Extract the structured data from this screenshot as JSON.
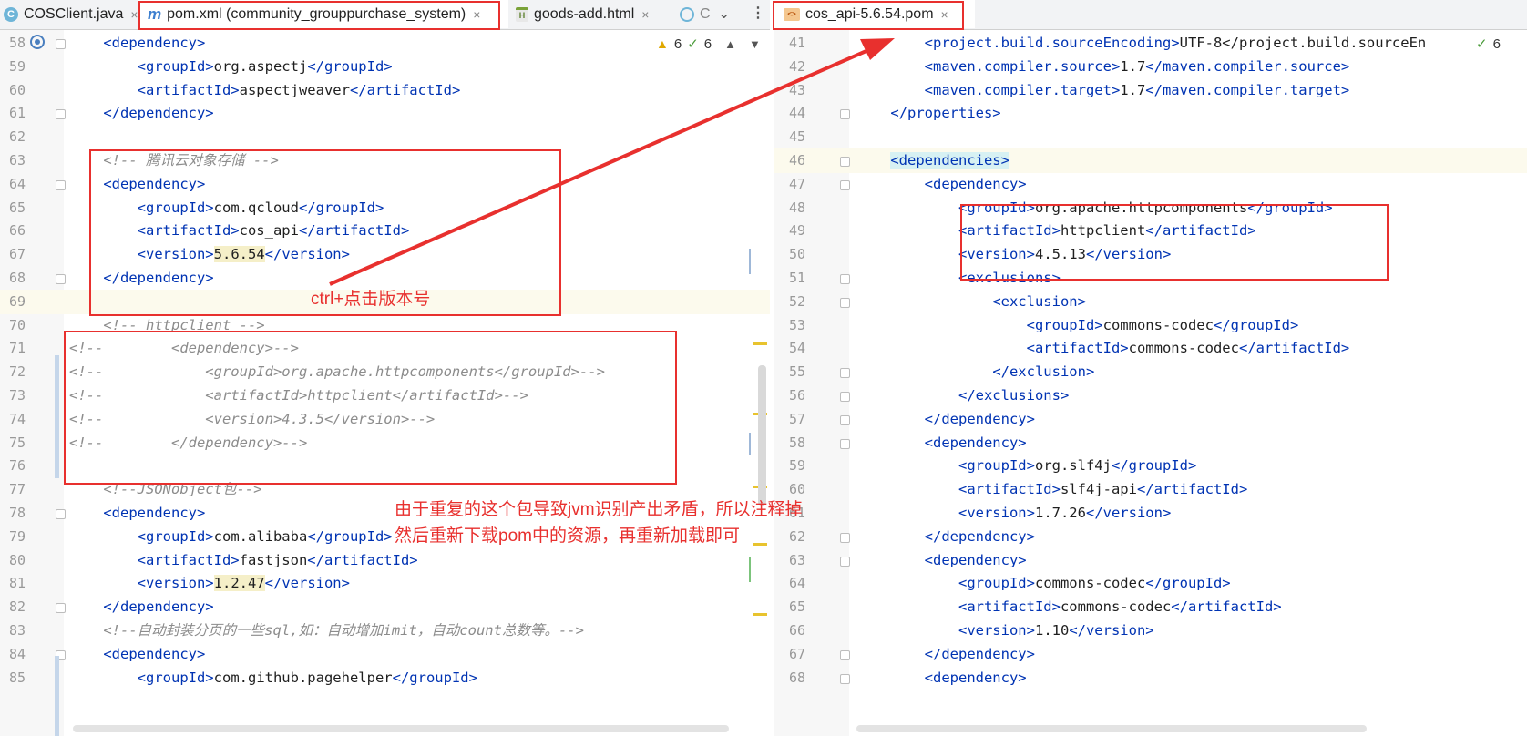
{
  "tabs_left": [
    {
      "label": "COSClient.java",
      "icon": "java-class-icon"
    },
    {
      "label": "pom.xml (community_grouppurchase_system)",
      "icon": "maven-icon"
    },
    {
      "label": "goods-add.html",
      "icon": "html-file-icon"
    },
    {
      "label": "C",
      "icon": "java-class-icon"
    }
  ],
  "tabs_right": [
    {
      "label": "cos_api-5.6.54.pom",
      "icon": "pom-file-icon"
    }
  ],
  "close_glyph": "×",
  "inspections_left": {
    "warnings": "6",
    "ok": "6"
  },
  "inspections_right": {
    "ok": "6"
  },
  "annotations": {
    "ctrl_click": "ctrl+点击版本号",
    "conflict_line1": "由于重复的这个包导致jvm识别产出矛盾，所以注释掉",
    "conflict_line2": "然后重新下载pom中的资源，再重新加载即可"
  },
  "left_code": [
    {
      "n": "58",
      "text": "    <dependency>",
      "kind": "tag"
    },
    {
      "n": "59",
      "text": "        <groupId>org.aspectj</groupId>",
      "kind": "tag"
    },
    {
      "n": "60",
      "text": "        <artifactId>aspectjweaver</artifactId>",
      "kind": "tag"
    },
    {
      "n": "61",
      "text": "    </dependency>",
      "kind": "tag"
    },
    {
      "n": "62",
      "text": "",
      "kind": "plain"
    },
    {
      "n": "63",
      "text": "    <!-- 腾讯云对象存储 -->",
      "kind": "comment"
    },
    {
      "n": "64",
      "text": "    <dependency>",
      "kind": "tag"
    },
    {
      "n": "65",
      "text": "        <groupId>com.qcloud</groupId>",
      "kind": "tag"
    },
    {
      "n": "66",
      "text": "        <artifactId>cos_api</artifactId>",
      "kind": "tag"
    },
    {
      "n": "67",
      "text": "        <version>5.6.54</version>",
      "kind": "tag",
      "hl": true
    },
    {
      "n": "68",
      "text": "    </dependency>",
      "kind": "tag"
    },
    {
      "n": "69",
      "text": "",
      "kind": "plain",
      "caret": true
    },
    {
      "n": "70",
      "text": "    <!-- httpclient -->",
      "kind": "comment"
    },
    {
      "n": "71",
      "text": "<!--        <dependency>-->",
      "kind": "comment"
    },
    {
      "n": "72",
      "text": "<!--            <groupId>org.apache.httpcomponents</groupId>-->",
      "kind": "comment"
    },
    {
      "n": "73",
      "text": "<!--            <artifactId>httpclient</artifactId>-->",
      "kind": "comment"
    },
    {
      "n": "74",
      "text": "<!--            <version>4.3.5</version>-->",
      "kind": "comment"
    },
    {
      "n": "75",
      "text": "<!--        </dependency>-->",
      "kind": "comment"
    },
    {
      "n": "76",
      "text": "",
      "kind": "plain"
    },
    {
      "n": "77",
      "text": "    <!--JSONobject包-->",
      "kind": "comment"
    },
    {
      "n": "78",
      "text": "    <dependency>",
      "kind": "tag"
    },
    {
      "n": "79",
      "text": "        <groupId>com.alibaba</groupId>",
      "kind": "tag"
    },
    {
      "n": "80",
      "text": "        <artifactId>fastjson</artifactId>",
      "kind": "tag"
    },
    {
      "n": "81",
      "text": "        <version>1.2.47</version>",
      "kind": "tag",
      "hl": true
    },
    {
      "n": "82",
      "text": "    </dependency>",
      "kind": "tag"
    },
    {
      "n": "83",
      "text": "    <!--自动封装分页的一些sql,如：自动增加imit，自动count总数等。-->",
      "kind": "comment"
    },
    {
      "n": "84",
      "text": "    <dependency>",
      "kind": "tag"
    },
    {
      "n": "85",
      "text": "        <groupId>com.github.pagehelper</groupId>",
      "kind": "tag"
    }
  ],
  "right_code": [
    {
      "n": "41",
      "text": "        <project.build.sourceEncoding>UTF-8</project.build.sourceEn",
      "kind": "tag"
    },
    {
      "n": "42",
      "text": "        <maven.compiler.source>1.7</maven.compiler.source>",
      "kind": "tag"
    },
    {
      "n": "43",
      "text": "        <maven.compiler.target>1.7</maven.compiler.target>",
      "kind": "tag"
    },
    {
      "n": "44",
      "text": "    </properties>",
      "kind": "tag"
    },
    {
      "n": "45",
      "text": "",
      "kind": "plain"
    },
    {
      "n": "46",
      "text": "    <dependencies>",
      "kind": "tag",
      "hltag": true,
      "caret": true
    },
    {
      "n": "47",
      "text": "        <dependency>",
      "kind": "tag"
    },
    {
      "n": "48",
      "text": "            <groupId>org.apache.httpcomponents</groupId>",
      "kind": "tag"
    },
    {
      "n": "49",
      "text": "            <artifactId>httpclient</artifactId>",
      "kind": "tag"
    },
    {
      "n": "50",
      "text": "            <version>4.5.13</version>",
      "kind": "tag"
    },
    {
      "n": "51",
      "text": "            <exclusions>",
      "kind": "tag"
    },
    {
      "n": "52",
      "text": "                <exclusion>",
      "kind": "tag"
    },
    {
      "n": "53",
      "text": "                    <groupId>commons-codec</groupId>",
      "kind": "tag"
    },
    {
      "n": "54",
      "text": "                    <artifactId>commons-codec</artifactId>",
      "kind": "tag"
    },
    {
      "n": "55",
      "text": "                </exclusion>",
      "kind": "tag"
    },
    {
      "n": "56",
      "text": "            </exclusions>",
      "kind": "tag"
    },
    {
      "n": "57",
      "text": "        </dependency>",
      "kind": "tag"
    },
    {
      "n": "58",
      "text": "        <dependency>",
      "kind": "tag"
    },
    {
      "n": "59",
      "text": "            <groupId>org.slf4j</groupId>",
      "kind": "tag"
    },
    {
      "n": "60",
      "text": "            <artifactId>slf4j-api</artifactId>",
      "kind": "tag"
    },
    {
      "n": "61",
      "text": "            <version>1.7.26</version>",
      "kind": "tag"
    },
    {
      "n": "62",
      "text": "        </dependency>",
      "kind": "tag"
    },
    {
      "n": "63",
      "text": "        <dependency>",
      "kind": "tag"
    },
    {
      "n": "64",
      "text": "            <groupId>commons-codec</groupId>",
      "kind": "tag"
    },
    {
      "n": "65",
      "text": "            <artifactId>commons-codec</artifactId>",
      "kind": "tag"
    },
    {
      "n": "66",
      "text": "            <version>1.10</version>",
      "kind": "tag"
    },
    {
      "n": "67",
      "text": "        </dependency>",
      "kind": "tag"
    },
    {
      "n": "68",
      "text": "        <dependency>",
      "kind": "tag"
    }
  ],
  "colors": {
    "annotation": "#e8302e",
    "tag": "#0033b3",
    "comment": "#8c8c8c"
  }
}
